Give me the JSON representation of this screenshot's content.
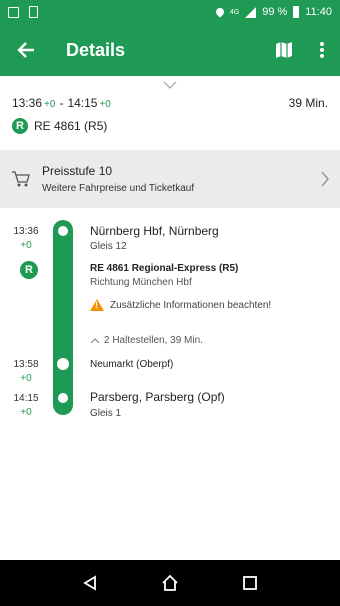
{
  "status_bar": {
    "battery": "99 %",
    "time": "11:40",
    "signal_label": "4G"
  },
  "toolbar": {
    "title": "Details"
  },
  "summary": {
    "departure_time": "13:36",
    "departure_delay": "+0",
    "dash": "-",
    "arrival_time": "14:15",
    "arrival_delay": "+0",
    "duration": "39 Min.",
    "train_badge": "R",
    "train": "RE 4861 (R5)"
  },
  "price": {
    "title": "Preisstufe 10",
    "subtitle": "Weitere Fahrpreise und Ticketkauf"
  },
  "journey": {
    "origin": {
      "time": "13:36",
      "delay": "+0",
      "name": "Nürnberg Hbf, Nürnberg",
      "platform": "Gleis 12"
    },
    "train_badge": "R",
    "train_name": "RE 4861 Regional-Express (R5)",
    "direction": "Richtung München Hbf",
    "notice": "Zusätzliche Informationen beachten!",
    "stops_toggle": "2 Haltestellen, 39 Min.",
    "intermediate": {
      "time": "13:58",
      "delay": "+0",
      "name": "Neumarkt (Oberpf)"
    },
    "destination": {
      "time": "14:15",
      "delay": "+0",
      "name": "Parsberg, Parsberg (Opf)",
      "platform": "Gleis 1"
    }
  },
  "colors": {
    "accent": "#1f9a55",
    "warning": "#f29400",
    "price_bg": "#ebebeb"
  }
}
